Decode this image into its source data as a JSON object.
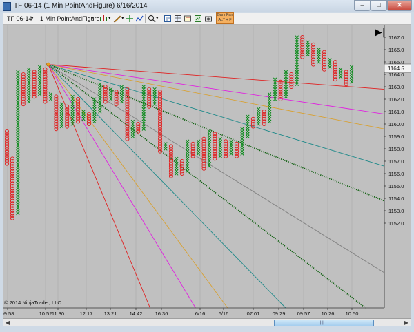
{
  "window": {
    "title": "TF 06-14 (1 Min PointAndFigure)  6/16/2014",
    "minimize_label": "‒",
    "maximize_label": "□",
    "close_label": "✕"
  },
  "toolbar": {
    "instrument": "TF 06-14",
    "interval": "1 Min PointAndFigure",
    "hotkey_line1": "GannFan",
    "hotkey_line2": "ALT + F"
  },
  "chart": {
    "copyright": "© 2014 NinjaTrader, LLC",
    "last_price": "1164.5",
    "play_icon": "▶|",
    "colors": {
      "background": "#c0c0c0",
      "x_box": "#0a8a1a",
      "o_box": "#e02020",
      "axis_text": "#111111",
      "last_price_bg": "#f4f4f4"
    }
  },
  "chart_data": {
    "type": "point_and_figure",
    "y_axis_ticks": [
      "1167.0",
      "1166.0",
      "1165.0",
      "1164.0",
      "1163.0",
      "1162.0",
      "1161.0",
      "1160.0",
      "1159.0",
      "1158.0",
      "1157.0",
      "1156.0",
      "1155.0",
      "1154.0",
      "1153.0",
      "1152.0"
    ],
    "x_axis_ticks": [
      "09:58",
      "10:52",
      "11:30",
      "12:17",
      "13:21",
      "14:42",
      "16:36",
      "6/16",
      "6/16",
      "07:01",
      "09:29",
      "09:57",
      "10:26",
      "10:50"
    ],
    "columns": [
      {
        "t": "o",
        "hi": 1159.5,
        "lo": 1156.8
      },
      {
        "t": "o",
        "hi": 1157.3,
        "lo": 1152.4
      },
      {
        "t": "x",
        "lo": 1152.8,
        "hi": 1164.2
      },
      {
        "t": "o",
        "hi": 1164.0,
        "lo": 1161.6
      },
      {
        "t": "x",
        "lo": 1161.8,
        "hi": 1164.4
      },
      {
        "t": "o",
        "hi": 1164.2,
        "lo": 1162.2
      },
      {
        "t": "x",
        "lo": 1162.4,
        "hi": 1164.7
      },
      {
        "t": "o",
        "hi": 1164.5,
        "lo": 1161.8
      },
      {
        "t": "x",
        "lo": 1162.0,
        "hi": 1162.4
      },
      {
        "t": "o",
        "hi": 1162.2,
        "lo": 1159.6
      },
      {
        "t": "x",
        "lo": 1159.8,
        "hi": 1161.6
      },
      {
        "t": "o",
        "hi": 1161.4,
        "lo": 1159.8
      },
      {
        "t": "x",
        "lo": 1160.0,
        "hi": 1162.2
      },
      {
        "t": "o",
        "hi": 1162.0,
        "lo": 1160.2
      },
      {
        "t": "x",
        "lo": 1160.4,
        "hi": 1161.0
      },
      {
        "t": "o",
        "hi": 1160.8,
        "lo": 1160.0
      },
      {
        "t": "x",
        "lo": 1160.2,
        "hi": 1162.0
      },
      {
        "t": "x",
        "lo": 1161.0,
        "hi": 1163.2
      },
      {
        "t": "o",
        "hi": 1163.0,
        "lo": 1161.8
      },
      {
        "t": "x",
        "lo": 1162.0,
        "hi": 1162.8
      },
      {
        "t": "o",
        "hi": 1162.6,
        "lo": 1161.6
      },
      {
        "t": "x",
        "lo": 1161.8,
        "hi": 1163.0
      },
      {
        "t": "o",
        "hi": 1162.8,
        "lo": 1158.8
      },
      {
        "t": "x",
        "lo": 1159.0,
        "hi": 1160.2
      },
      {
        "t": "o",
        "hi": 1160.0,
        "lo": 1159.4
      },
      {
        "t": "x",
        "lo": 1159.6,
        "hi": 1163.0
      },
      {
        "t": "o",
        "hi": 1162.8,
        "lo": 1161.4
      },
      {
        "t": "x",
        "lo": 1161.6,
        "hi": 1162.8
      },
      {
        "t": "o",
        "hi": 1162.6,
        "lo": 1157.8
      },
      {
        "t": "x",
        "lo": 1158.0,
        "hi": 1158.4
      },
      {
        "t": "o",
        "hi": 1158.2,
        "lo": 1155.8
      },
      {
        "t": "x",
        "lo": 1156.0,
        "hi": 1157.2
      },
      {
        "t": "o",
        "hi": 1157.0,
        "lo": 1156.0
      },
      {
        "t": "x",
        "lo": 1156.2,
        "hi": 1158.6
      },
      {
        "t": "o",
        "hi": 1158.4,
        "lo": 1157.4
      },
      {
        "t": "x",
        "lo": 1157.6,
        "hi": 1158.6
      },
      {
        "t": "o",
        "hi": 1158.8,
        "lo": 1156.4
      },
      {
        "t": "x",
        "lo": 1156.6,
        "hi": 1159.4
      },
      {
        "t": "o",
        "hi": 1159.2,
        "lo": 1157.2
      },
      {
        "t": "x",
        "lo": 1157.4,
        "hi": 1158.8
      },
      {
        "t": "o",
        "hi": 1158.6,
        "lo": 1157.4
      },
      {
        "t": "x",
        "lo": 1157.6,
        "hi": 1158.6
      },
      {
        "t": "o",
        "hi": 1158.4,
        "lo": 1157.4
      },
      {
        "t": "x",
        "lo": 1157.6,
        "hi": 1159.6
      },
      {
        "t": "x",
        "lo": 1159.0,
        "hi": 1160.6
      },
      {
        "t": "o",
        "hi": 1160.4,
        "lo": 1159.8
      },
      {
        "t": "x",
        "lo": 1160.0,
        "hi": 1161.2
      },
      {
        "t": "o",
        "hi": 1161.0,
        "lo": 1160.0
      },
      {
        "t": "x",
        "lo": 1160.2,
        "hi": 1162.4
      },
      {
        "t": "x",
        "lo": 1162.0,
        "hi": 1163.6
      },
      {
        "t": "o",
        "hi": 1163.4,
        "lo": 1162.0
      },
      {
        "t": "x",
        "lo": 1162.2,
        "hi": 1164.2
      },
      {
        "t": "o",
        "hi": 1164.0,
        "lo": 1163.0
      },
      {
        "t": "x",
        "lo": 1163.2,
        "hi": 1167.0
      },
      {
        "t": "o",
        "hi": 1167.0,
        "lo": 1165.4
      },
      {
        "t": "x",
        "lo": 1165.6,
        "hi": 1166.6
      },
      {
        "t": "o",
        "hi": 1166.4,
        "lo": 1164.8
      },
      {
        "t": "x",
        "lo": 1165.0,
        "hi": 1166.0
      },
      {
        "t": "o",
        "hi": 1165.8,
        "lo": 1164.4
      },
      {
        "t": "x",
        "lo": 1164.6,
        "hi": 1165.2
      },
      {
        "t": "o",
        "hi": 1165.0,
        "lo": 1163.6
      },
      {
        "t": "x",
        "lo": 1163.8,
        "hi": 1164.4
      },
      {
        "t": "o",
        "hi": 1164.2,
        "lo": 1163.2
      },
      {
        "t": "x",
        "lo": 1163.4,
        "hi": 1164.6
      }
    ],
    "gann_fan": {
      "origin": {
        "x_label": "10:52",
        "price": 1164.8
      },
      "lines": [
        {
          "color": "#e02020",
          "style": "solid",
          "end_price": 1162.8
        },
        {
          "color": "#e020e0",
          "style": "solid",
          "end_price": 1160.8
        },
        {
          "color": "#d8a030",
          "style": "solid",
          "end_price": 1159.6
        },
        {
          "color": "#208a8a",
          "style": "solid",
          "end_price": 1156.6
        },
        {
          "color": "#106010",
          "style": "dotted",
          "end_price": 1153.8
        },
        {
          "color": "#808080",
          "style": "solid",
          "end_price": 1148.0
        },
        {
          "color": "#106010",
          "style": "dotted",
          "end_price": 1144.0
        },
        {
          "color": "#208a8a",
          "style": "solid",
          "end_price": 1137.0
        },
        {
          "color": "#d8a030",
          "style": "solid",
          "end_price": 1128.0
        },
        {
          "color": "#e020e0",
          "style": "solid",
          "end_price": 1120.0
        },
        {
          "color": "#e02020",
          "style": "solid",
          "end_price": 1100.0
        }
      ]
    }
  }
}
